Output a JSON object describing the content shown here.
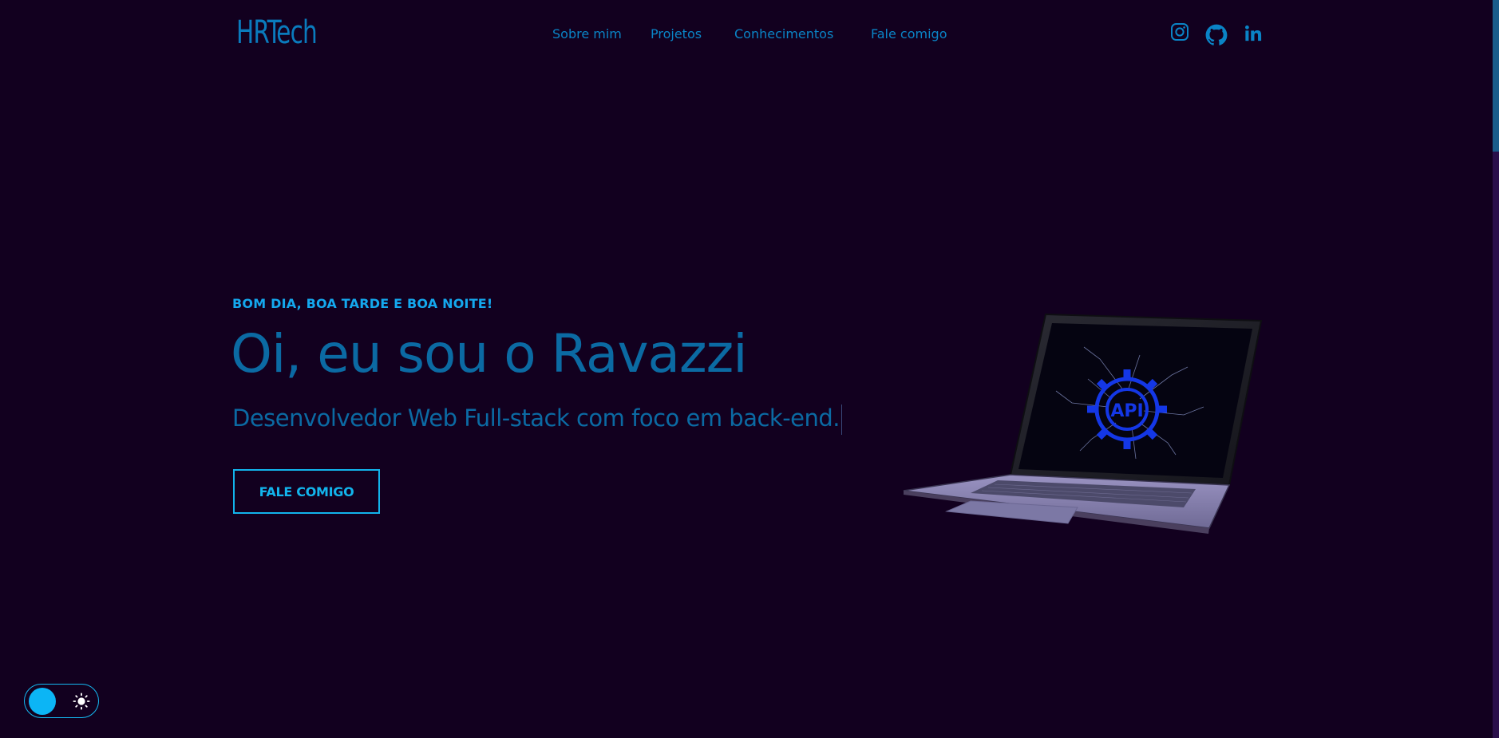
{
  "header": {
    "logo": "HRTech",
    "nav": [
      {
        "label": "Sobre mim"
      },
      {
        "label": "Projetos"
      },
      {
        "label": "Conhecimentos"
      },
      {
        "label": "Fale comigo"
      }
    ],
    "social": [
      {
        "icon": "instagram-icon"
      },
      {
        "icon": "github-icon"
      },
      {
        "icon": "linkedin-icon"
      }
    ]
  },
  "hero": {
    "greeting": "BOM DIA, BOA TARDE E BOA NOITE!",
    "title": "Oi, eu sou o Ravazzi",
    "subtitle": "Desenvolvedor Web Full-stack com foco em back-end.",
    "cta_label": "FALE COMIGO",
    "laptop_screen_label": "API"
  },
  "theme_toggle": {
    "icon": "sun-icon"
  },
  "colors": {
    "background": "#12001f",
    "accent": "#12b4ec",
    "title": "#0b6aa3"
  }
}
